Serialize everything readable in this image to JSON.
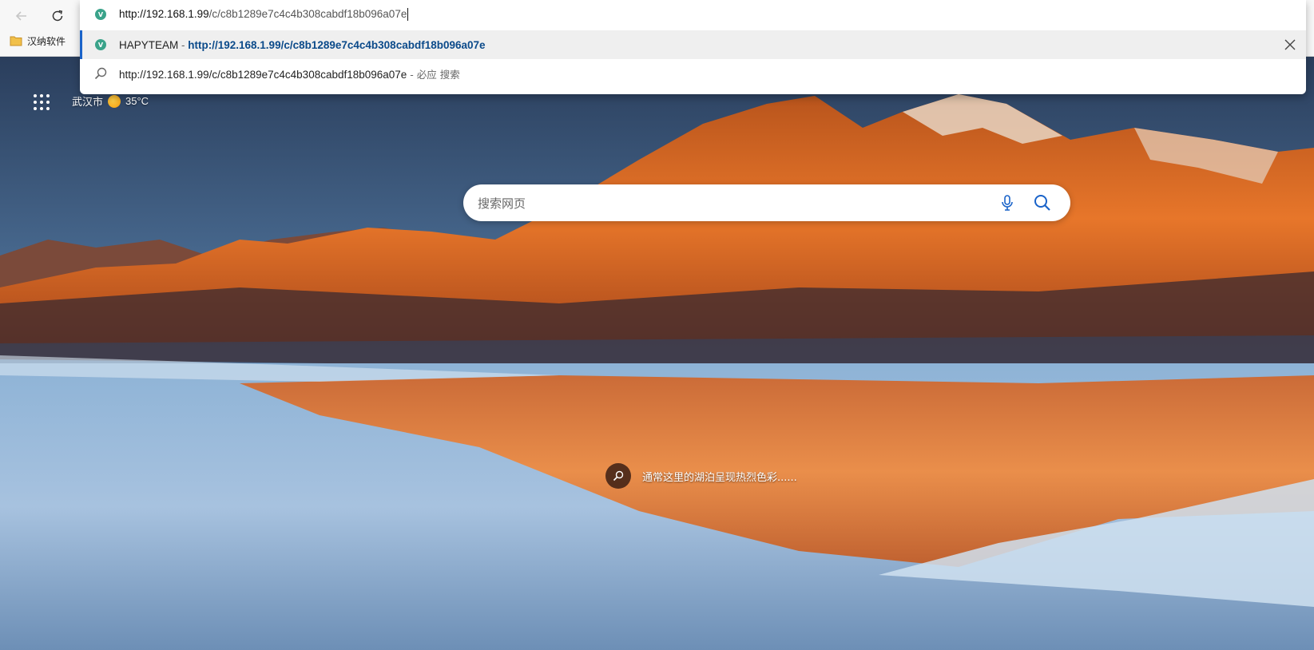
{
  "browser": {
    "bookmark_bar": {
      "items": [
        {
          "label": "汉纳软件",
          "icon": "folder-icon"
        }
      ]
    },
    "omnibox": {
      "url_host": "http://192.168.1.99",
      "url_path": "/c/c8b1289e7c4c4b308cabdf18b096a07e",
      "suggestions": [
        {
          "site": "HAPYTEAM",
          "separator": " - ",
          "url": "http://192.168.1.99/c/c8b1289e7c4c4b308cabdf18b096a07e",
          "icon": "site-favicon"
        },
        {
          "query": "http://192.168.1.99/c/c8b1289e7c4c4b308cabdf18b096a07e",
          "engine_suffix": " - 必应 搜索",
          "icon": "search-icon"
        }
      ]
    }
  },
  "newtab": {
    "weather": {
      "city": "武汉市",
      "temperature": "35°C",
      "icon": "sun-icon"
    },
    "search": {
      "placeholder": "搜索网页"
    },
    "background_caption": "通常这里的湖泊呈现热烈色彩......"
  },
  "colors": {
    "accent": "#1a63c9",
    "suggestion_url": "#0b4a8a",
    "chrome_bg": "#f7f7f7"
  }
}
